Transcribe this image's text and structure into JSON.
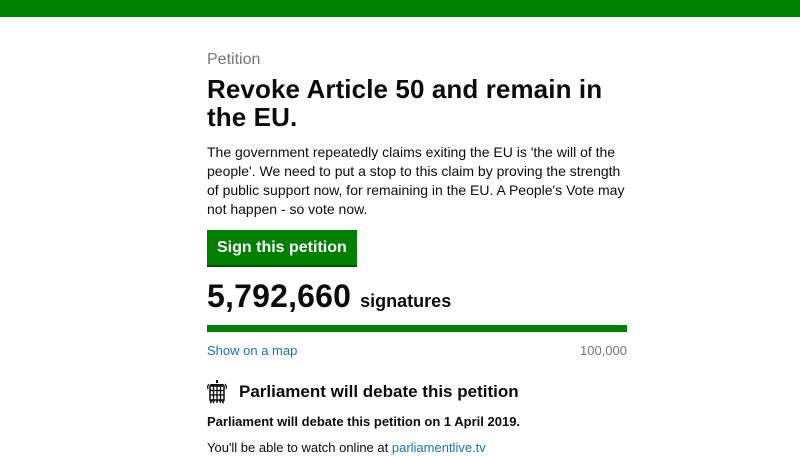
{
  "header": {
    "bar_color": "#008000"
  },
  "petition": {
    "caption": "Petition",
    "title": "Revoke Article 50 and remain in the EU.",
    "description": "The government repeatedly claims exiting the EU is 'the will of the people'. We need to put a stop to this claim by proving the strength of public support now, for remaining in the EU. A People's Vote may not happen - so vote now.",
    "sign_button_label": "Sign this petition"
  },
  "signatures": {
    "count": "5,792,660",
    "label": "signatures",
    "progress_fraction": 1.0,
    "map_link_label": "Show on a map",
    "threshold": "100,000"
  },
  "debate": {
    "icon": "portcullis-icon",
    "heading": "Parliament will debate this petition",
    "date_text": "Parliament will debate this petition on 1 April 2019.",
    "watch_prefix": "You'll be able to watch online at ",
    "watch_link": "parliamentlive.tv"
  },
  "colors": {
    "accent": "#008000",
    "link": "#1d70b8",
    "muted": "#6f777b"
  }
}
